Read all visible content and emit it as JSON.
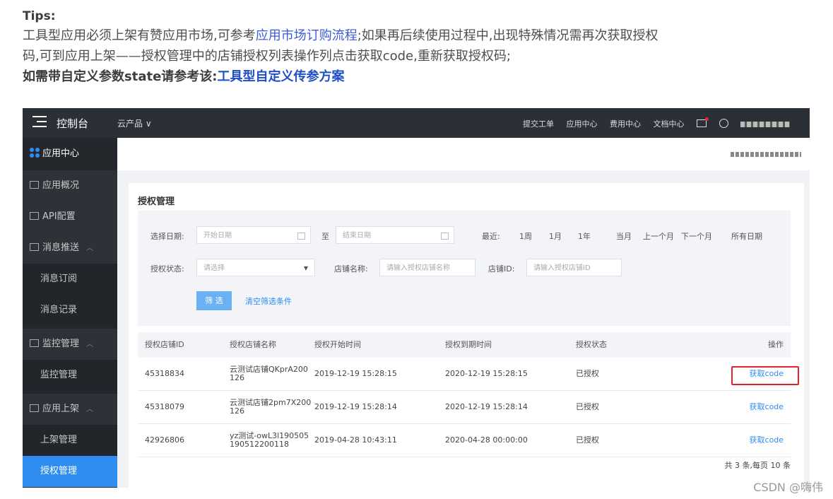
{
  "tips": {
    "title": "Tips:",
    "line1_pre": "工具型应用必须上架有赞应用市场,可参考",
    "line1_link": "应用市场订购流程",
    "line1_post": ";如果再后续使用过程中,出现特殊情况需再次获取授权",
    "line2": "码,可到应用上架——授权管理中的店铺授权列表操作列点击获取code,重新获取授权码;",
    "line3_pre": "如需带自定义参数state请参考该:",
    "line3_link": "工具型自定义传参方案"
  },
  "topbar": {
    "console": "控制台",
    "cloud_products": "云产品 ∨",
    "links": [
      "提交工单",
      "应用中心",
      "费用中心",
      "文档中心"
    ],
    "icons": [
      "mail-icon",
      "user-icon"
    ]
  },
  "sidebar": {
    "header": "应用中心",
    "items": [
      {
        "label": "应用概况"
      },
      {
        "label": "API配置"
      },
      {
        "label": "消息推送"
      },
      {
        "label": "消息订阅"
      },
      {
        "label": "消息记录"
      },
      {
        "label": "监控管理"
      },
      {
        "label": "监控管理"
      },
      {
        "label": "应用上架"
      },
      {
        "label": "上架管理"
      },
      {
        "label": "授权管理"
      }
    ]
  },
  "page": {
    "title": "授权管理",
    "filter": {
      "date_label": "选择日期:",
      "start_placeholder": "开始日期",
      "to": "至",
      "end_placeholder": "结束日期",
      "recent_label": "最近:",
      "quick": [
        "1周",
        "1月",
        "1年",
        "当月",
        "上一个月",
        "下一个月",
        "所有日期"
      ],
      "status_label": "授权状态:",
      "status_placeholder": "请选择",
      "shop_name_label": "店铺名称:",
      "shop_name_placeholder": "请输入授权店铺名称",
      "shop_id_label": "店铺ID:",
      "shop_id_placeholder": "请输入授权店铺ID",
      "filter_button": "筛 选",
      "clear_link": "清空筛选条件"
    },
    "table": {
      "headers": [
        "授权店铺ID",
        "授权店铺名称",
        "授权开始时间",
        "授权到期时间",
        "授权状态",
        "操作"
      ],
      "rows": [
        {
          "id": "45318834",
          "name": "云测试店铺QKprA200126",
          "start": "2019-12-19 15:28:15",
          "end": "2020-12-19 15:28:15",
          "status": "已授权",
          "op": "获取code"
        },
        {
          "id": "45318079",
          "name": "云测试店铺2pm7X200126",
          "start": "2019-12-19 15:28:14",
          "end": "2020-12-19 15:28:14",
          "status": "已授权",
          "op": "获取code"
        },
        {
          "id": "42926806",
          "name": "yz测试-owL3l190505190512200118",
          "start": "2019-04-28 10:43:11",
          "end": "2020-04-28 00:00:00",
          "status": "已授权",
          "op": "获取code"
        }
      ],
      "pager": "共 3 条,每页 10 条"
    }
  },
  "watermark": "CSDN @嗨伟"
}
